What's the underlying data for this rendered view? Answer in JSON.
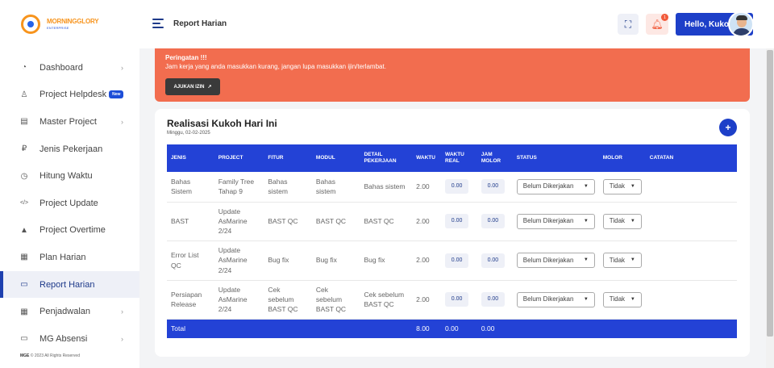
{
  "brand": {
    "name": "MORNINGGLORY",
    "tagline": "ENTERPRISE"
  },
  "sidebar": {
    "items": [
      {
        "label": "Dashboard",
        "icon": "dashboard-icon",
        "chevron": true,
        "active": false
      },
      {
        "label": "Project Helpdesk",
        "icon": "helpdesk-icon",
        "chevron": false,
        "badge": "New",
        "active": false
      },
      {
        "label": "Master Project",
        "icon": "list-icon",
        "chevron": true,
        "active": false
      },
      {
        "label": "Jenis Pekerjaan",
        "icon": "rupiah-icon",
        "chevron": false,
        "active": false
      },
      {
        "label": "Hitung Waktu",
        "icon": "clock-icon",
        "chevron": false,
        "active": false
      },
      {
        "label": "Project Update",
        "icon": "code-icon",
        "chevron": false,
        "active": false
      },
      {
        "label": "Project Overtime",
        "icon": "warning-icon",
        "chevron": false,
        "active": false
      },
      {
        "label": "Plan Harian",
        "icon": "calendar-check-icon",
        "chevron": false,
        "active": false
      },
      {
        "label": "Report Harian",
        "icon": "report-icon",
        "chevron": false,
        "active": true
      },
      {
        "label": "Penjadwalan",
        "icon": "calendar-icon",
        "chevron": true,
        "active": false
      },
      {
        "label": "MG Absensi",
        "icon": "id-card-icon",
        "chevron": true,
        "active": false
      }
    ],
    "copyright_brand": "MGE",
    "copyright_text": " © 2023 All Rights Reserved"
  },
  "header": {
    "title": "Report Harian",
    "notification_count": "1",
    "user_label": "Hello, Kukoh"
  },
  "warning": {
    "title": "Peringatan !!!",
    "text": "Jam kerja yang anda masukkan kurang, jangan lupa masukkan ijin/terlambat.",
    "button_label": "AJUKAN IZIN"
  },
  "report": {
    "title": "Realisasi Kukoh Hari Ini",
    "date": "Minggu, 02-02-2025",
    "columns": [
      "JENIS",
      "PROJECT",
      "FITUR",
      "MODUL",
      "DETAIL PEKERJAAN",
      "WAKTU",
      "WAKTU REAL",
      "JAM MOLOR",
      "STATUS",
      "MOLOR",
      "CATATAN"
    ],
    "rows": [
      {
        "jenis": "Bahas Sistem",
        "project": "Family Tree Tahap 9",
        "fitur": "Bahas sistem",
        "modul": "Bahas sistem",
        "detail": "Bahas sistem",
        "waktu": "2.00",
        "waktu_real": "0.00",
        "jam_molor": "0.00",
        "status": "Belum Dikerjakan",
        "molor": "Tidak",
        "catatan": ""
      },
      {
        "jenis": "BAST",
        "project": "Update AsMarine 2/24",
        "fitur": "BAST QC",
        "modul": "BAST QC",
        "detail": "BAST QC",
        "waktu": "2.00",
        "waktu_real": "0.00",
        "jam_molor": "0.00",
        "status": "Belum Dikerjakan",
        "molor": "Tidak",
        "catatan": ""
      },
      {
        "jenis": "Error List QC",
        "project": "Update AsMarine 2/24",
        "fitur": "Bug fix",
        "modul": "Bug fix",
        "detail": "Bug fix",
        "waktu": "2.00",
        "waktu_real": "0.00",
        "jam_molor": "0.00",
        "status": "Belum Dikerjakan",
        "molor": "Tidak",
        "catatan": ""
      },
      {
        "jenis": "Persiapan Release",
        "project": "Update AsMarine 2/24",
        "fitur": "Cek sebelum BAST QC",
        "modul": "Cek sebelum BAST QC",
        "detail": "Cek sebelum BAST QC",
        "waktu": "2.00",
        "waktu_real": "0.00",
        "jam_molor": "0.00",
        "status": "Belum Dikerjakan",
        "molor": "Tidak",
        "catatan": ""
      }
    ],
    "total": {
      "label": "Total",
      "waktu": "8.00",
      "waktu_real": "0.00",
      "jam_molor": "0.00"
    }
  }
}
